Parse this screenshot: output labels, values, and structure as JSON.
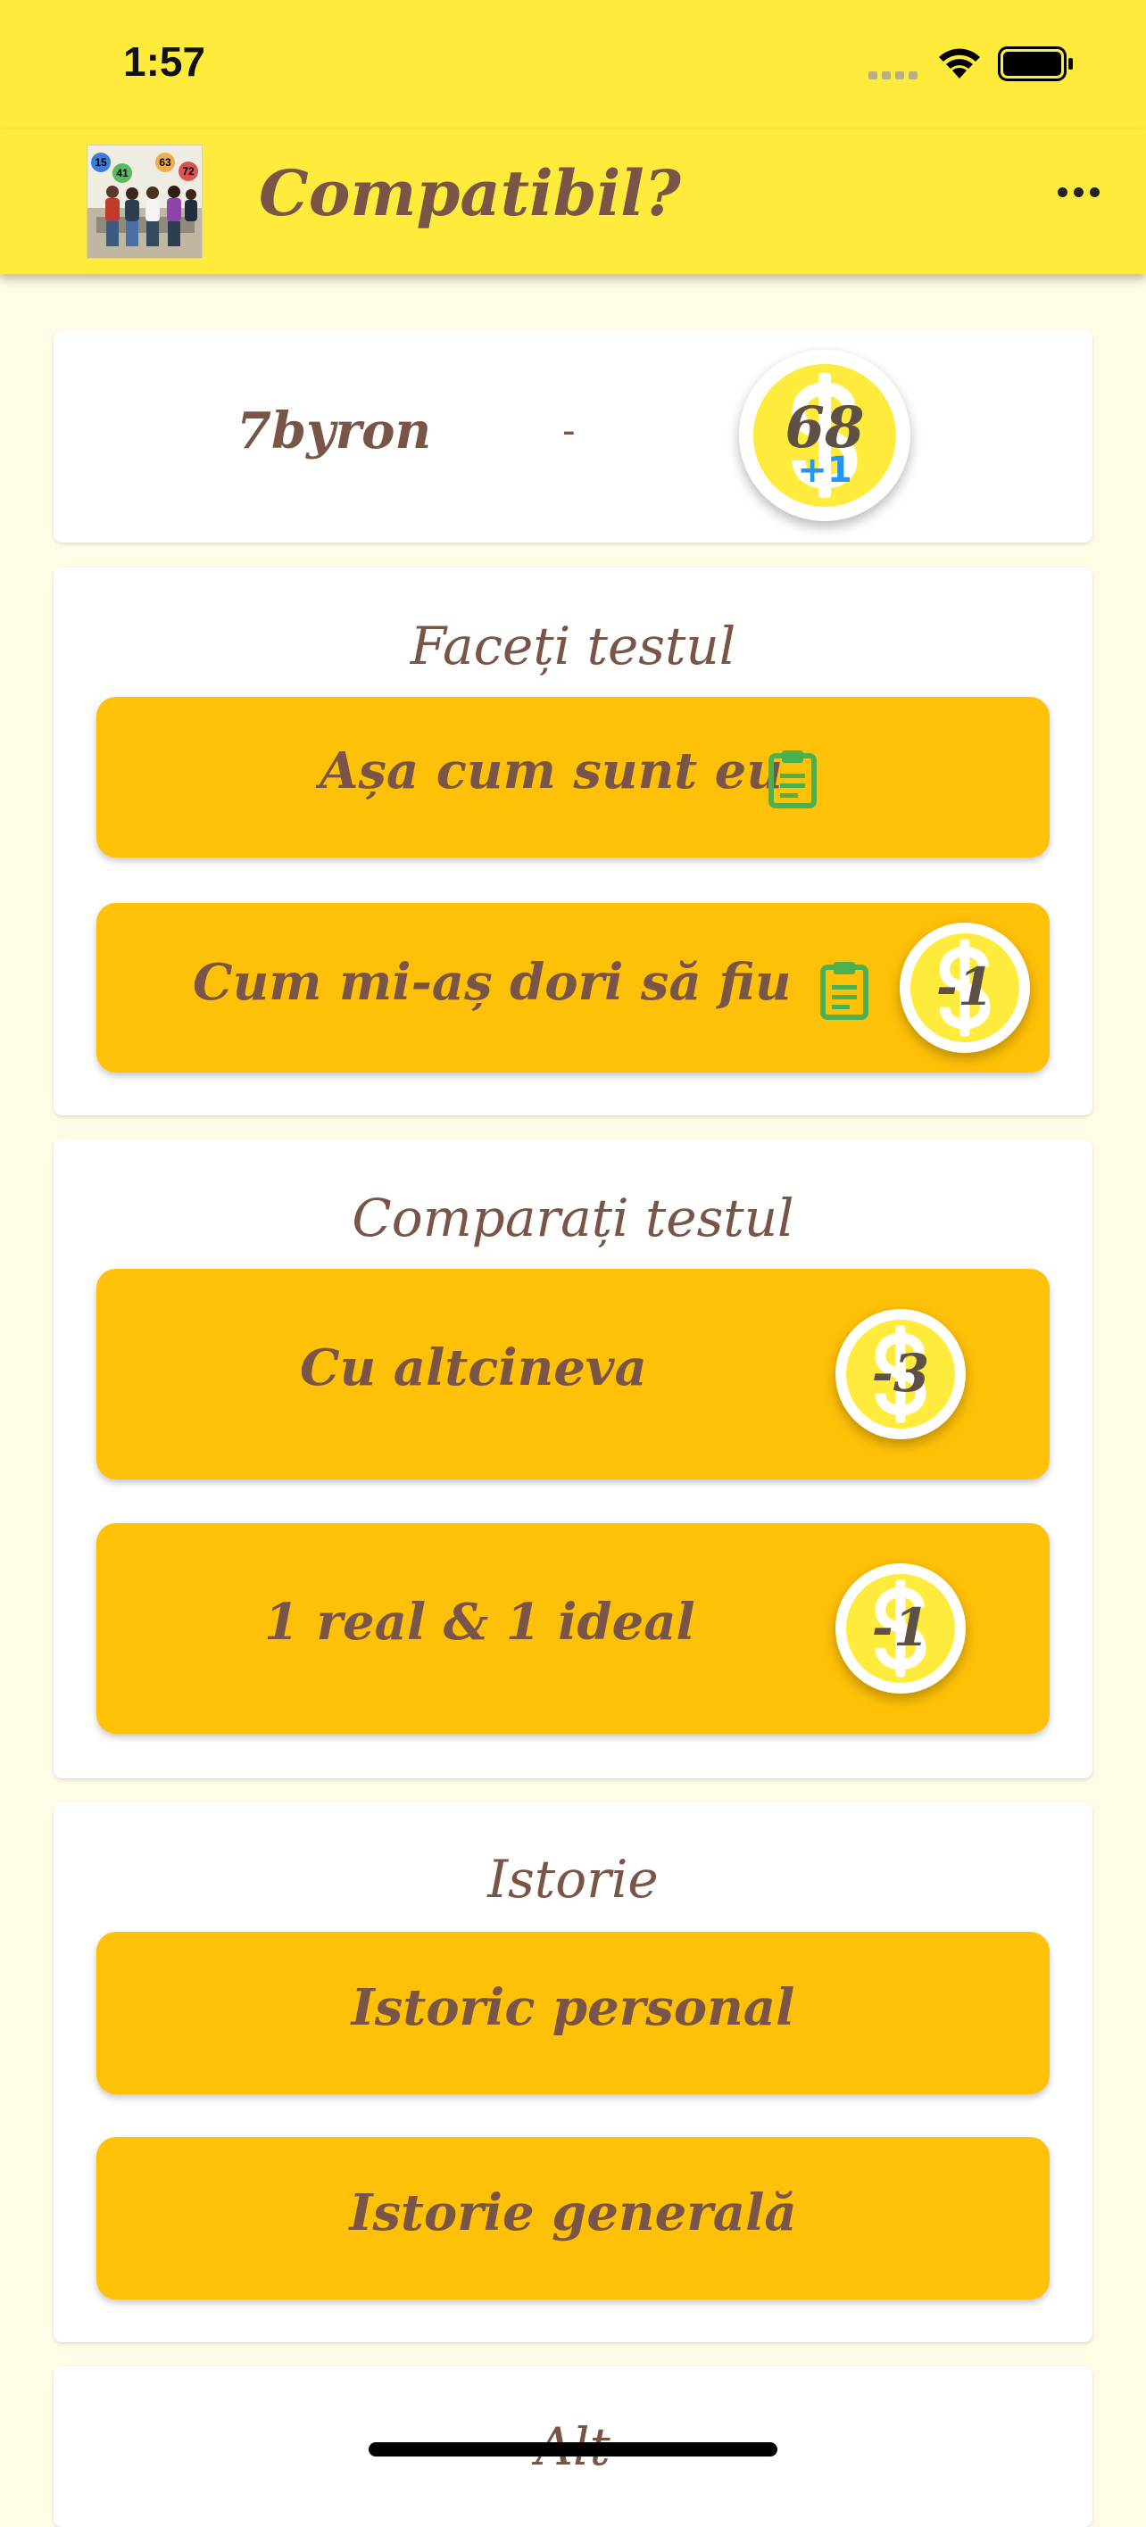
{
  "status_bar": {
    "time": "1:57"
  },
  "app_bar": {
    "title": "Compatibil?",
    "logo_badges": [
      "15",
      "41",
      "63",
      "72"
    ],
    "more_icon": "more-horizontal-icon"
  },
  "user_card": {
    "username": "7byron",
    "separator": "-",
    "coins": "68",
    "coins_delta": "+1"
  },
  "take_test": {
    "title": "Faceți testul",
    "buttons": [
      {
        "label": "Așa cum sunt eu",
        "icon": "clipboard-icon"
      },
      {
        "label": "Cum mi-aș dori să fiu",
        "icon": "clipboard-icon",
        "cost": "-1"
      }
    ]
  },
  "compare_test": {
    "title": "Comparați testul",
    "buttons": [
      {
        "label": "Cu altcineva",
        "cost": "-3"
      },
      {
        "label": "1 real & 1 ideal",
        "cost": "-1"
      }
    ]
  },
  "history": {
    "title": "Istorie",
    "buttons": [
      {
        "label": "Istoric personal"
      },
      {
        "label": "Istorie generală"
      }
    ]
  },
  "other": {
    "title": "Alt"
  },
  "colors": {
    "app_bar": "#ffeb3b",
    "background": "#fffbe6",
    "button": "#ffc107",
    "text": "#795548",
    "clipboard": "#4caf50",
    "coins_delta": "#2196f3"
  }
}
